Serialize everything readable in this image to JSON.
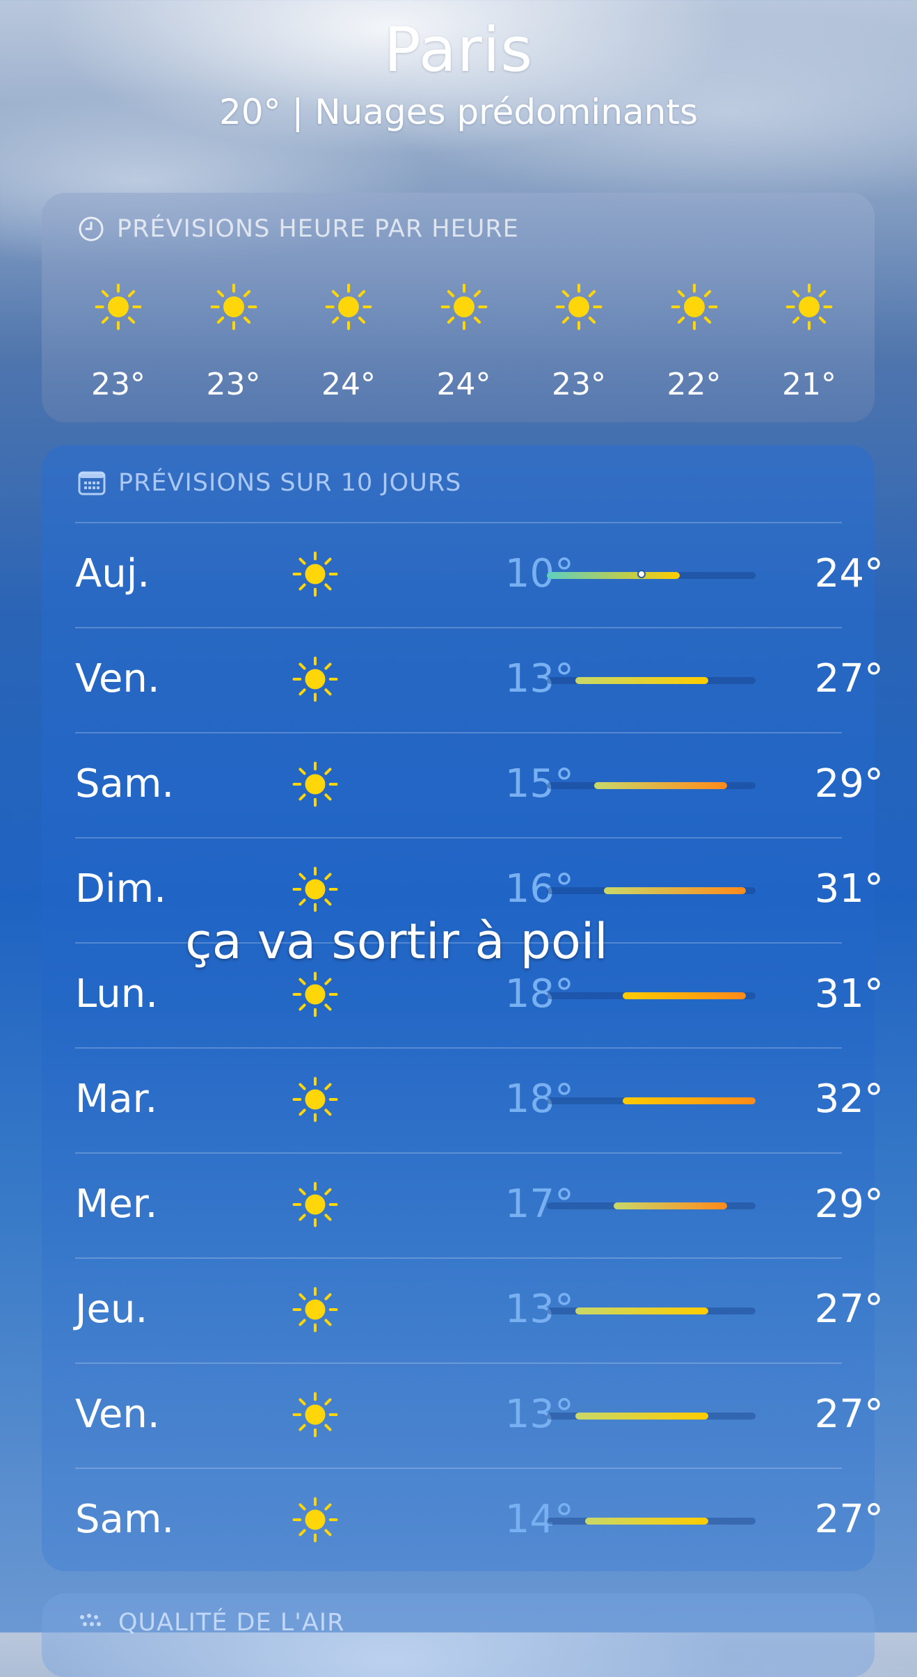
{
  "header": {
    "city": "Paris",
    "summary": "20°  |  Nuages prédominants"
  },
  "hourly": {
    "title": "PRÉVISIONS HEURE PAR HEURE",
    "icon": "clock-icon",
    "hours": [
      {
        "icon": "sun-icon",
        "temp": "23°"
      },
      {
        "icon": "sun-icon",
        "temp": "23°"
      },
      {
        "icon": "sun-icon",
        "temp": "24°"
      },
      {
        "icon": "sun-icon",
        "temp": "24°"
      },
      {
        "icon": "sun-icon",
        "temp": "23°"
      },
      {
        "icon": "sun-icon",
        "temp": "22°"
      },
      {
        "icon": "sun-icon",
        "temp": "21°"
      }
    ]
  },
  "daily": {
    "title": "PRÉVISIONS SUR 10 JOURS",
    "icon": "calendar-icon",
    "scale": {
      "min": 10,
      "max": 32
    },
    "days": [
      {
        "day": "Auj.",
        "icon": "sun-icon",
        "low": "10°",
        "high": "24°",
        "low_value": 10,
        "high_value": 24,
        "current_value": 20
      },
      {
        "day": "Ven.",
        "icon": "sun-icon",
        "low": "13°",
        "high": "27°",
        "low_value": 13,
        "high_value": 27
      },
      {
        "day": "Sam.",
        "icon": "sun-icon",
        "low": "15°",
        "high": "29°",
        "low_value": 15,
        "high_value": 29
      },
      {
        "day": "Dim.",
        "icon": "sun-icon",
        "low": "16°",
        "high": "31°",
        "low_value": 16,
        "high_value": 31
      },
      {
        "day": "Lun.",
        "icon": "sun-icon",
        "low": "18°",
        "high": "31°",
        "low_value": 18,
        "high_value": 31
      },
      {
        "day": "Mar.",
        "icon": "sun-icon",
        "low": "18°",
        "high": "32°",
        "low_value": 18,
        "high_value": 32
      },
      {
        "day": "Mer.",
        "icon": "sun-icon",
        "low": "17°",
        "high": "29°",
        "low_value": 17,
        "high_value": 29
      },
      {
        "day": "Jeu.",
        "icon": "sun-icon",
        "low": "13°",
        "high": "27°",
        "low_value": 13,
        "high_value": 27
      },
      {
        "day": "Ven.",
        "icon": "sun-icon",
        "low": "13°",
        "high": "27°",
        "low_value": 13,
        "high_value": 27
      },
      {
        "day": "Sam.",
        "icon": "sun-icon",
        "low": "14°",
        "high": "27°",
        "low_value": 14,
        "high_value": 27
      }
    ]
  },
  "air_quality": {
    "title": "QUALITÉ DE L'AIR",
    "icon": "air-quality-icon"
  },
  "overlay_caption": "ça va sortir à poil",
  "colors": {
    "sun": "#ffd60a",
    "low_temp": "#78b0f2",
    "bar_cool": "#5ecfc0",
    "bar_mild": "#c8d86a",
    "bar_warm": "#ffcc00",
    "bar_hot": "#ff8a1a"
  }
}
